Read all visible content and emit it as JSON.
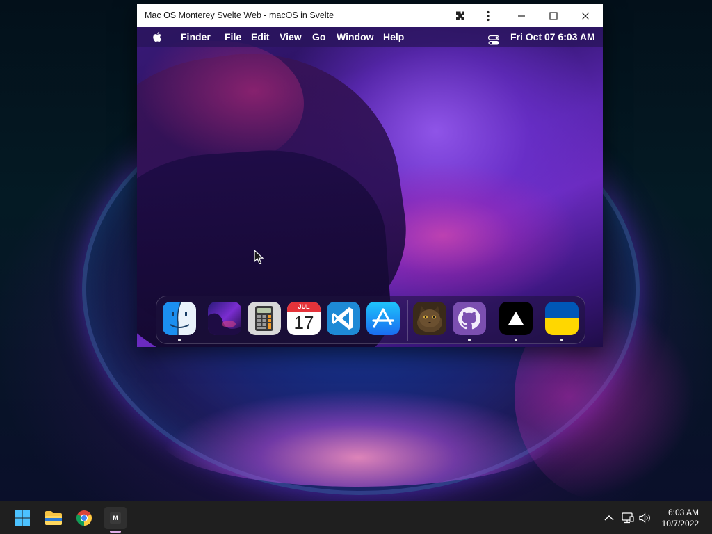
{
  "window": {
    "title": "Mac OS Monterey Svelte Web - macOS in Svelte"
  },
  "mac": {
    "menubar": {
      "app_name": "Finder",
      "items": [
        "File",
        "Edit",
        "View",
        "Go",
        "Window",
        "Help"
      ],
      "clock": "Fri Oct 07  6:03 AM"
    },
    "dock": {
      "apps": [
        {
          "name": "finder-app",
          "running": true
        },
        {
          "name": "wallpapers-app",
          "running": false
        },
        {
          "name": "calculator-app",
          "running": false
        },
        {
          "name": "calendar-app",
          "running": false,
          "month": "JUL",
          "day": "17"
        },
        {
          "name": "vscode-app",
          "running": false
        },
        {
          "name": "app-store-app",
          "running": false
        },
        {
          "name": "purrple-cat-app",
          "running": false
        },
        {
          "name": "github-app",
          "running": true
        },
        {
          "name": "vercel-app",
          "running": true
        },
        {
          "name": "ukraine-flag-app",
          "running": true
        }
      ]
    }
  },
  "taskbar": {
    "time": "6:03 AM",
    "date": "10/7/2022",
    "active_app_letter": "M"
  },
  "colors": {
    "ukraine_blue": "#0057b7",
    "ukraine_yellow": "#ffd700",
    "taskbar_bg": "#1f1f1f"
  }
}
